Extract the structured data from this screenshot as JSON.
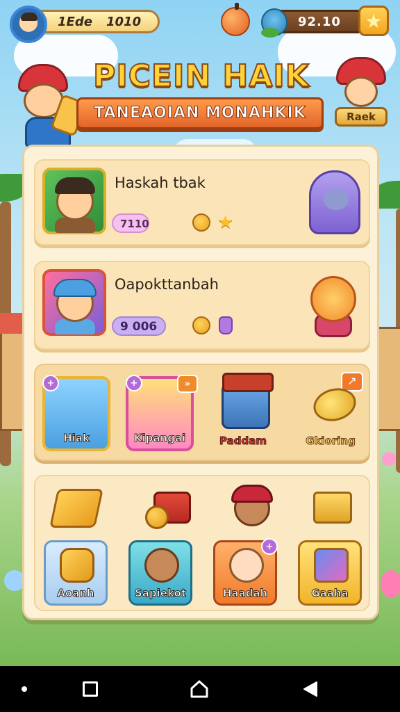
{
  "header": {
    "player_pill_text": "1Ede",
    "player_pill_value": "1010",
    "currency_value": "92.10"
  },
  "title": {
    "main": "PICEIN HAIK",
    "subtitle": "TANEAOIAN MONAHKIK",
    "side_tag": "Raek"
  },
  "cards": [
    {
      "name": "Haskah tbak",
      "badge": "7110"
    },
    {
      "name": "Oapokttanbah",
      "badge": "9 006"
    }
  ],
  "row_tiles": [
    {
      "label": "Hiak"
    },
    {
      "label": "Kipangai"
    },
    {
      "label": "Paddam"
    },
    {
      "label": "Gkioring"
    }
  ],
  "bottom_tiles": [
    {
      "label": "Aoanh"
    },
    {
      "label": "Sapiekot"
    },
    {
      "label": "Haadah"
    },
    {
      "label": "Gaaha"
    }
  ],
  "icons": {
    "avatar": "player-avatar-icon",
    "orange": "orange-fruit-icon",
    "frog": "frog-icon",
    "star": "star-icon"
  },
  "colors": {
    "panel_bg": "#fdf2d8",
    "title_gold": "#ffd23a",
    "banner_orange": "#e2652a"
  }
}
